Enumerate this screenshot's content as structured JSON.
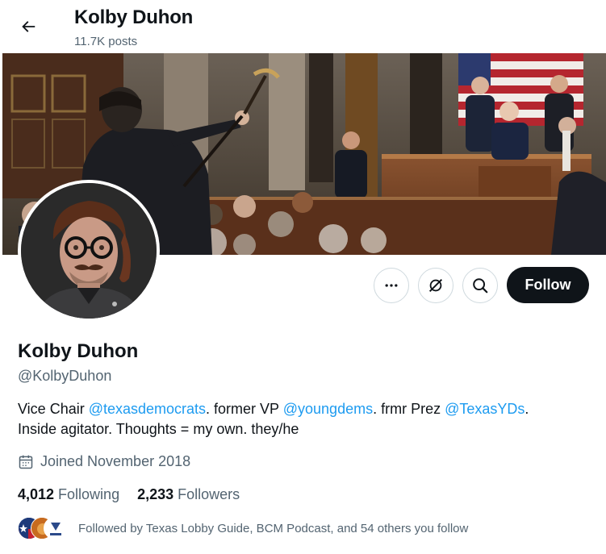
{
  "header": {
    "title": "Kolby Duhon",
    "posts_count": "11.7K posts",
    "back_icon": "arrow-left-icon"
  },
  "profile": {
    "name": "Kolby Duhon",
    "handle": "@KolbyDuhon",
    "bio": [
      {
        "text": "Vice Chair ",
        "type": "text"
      },
      {
        "text": "@texasdemocrats",
        "type": "mention"
      },
      {
        "text": ". former VP ",
        "type": "text"
      },
      {
        "text": "@youngdems",
        "type": "mention"
      },
      {
        "text": ". frmr Prez ",
        "type": "text"
      },
      {
        "text": "@TexasYDs",
        "type": "mention"
      },
      {
        "text": ".\nInside agitator. Thoughts = my own. they/he",
        "type": "text"
      }
    ],
    "joined": "Joined November 2018",
    "following_count": "4,012",
    "following_label": "Following",
    "followers_count": "2,233",
    "followers_label": "Followers",
    "followed_by": "Followed by Texas Lobby Guide, BCM Podcast, and 54 others you follow"
  },
  "actions": {
    "more_icon": "more-dots-icon",
    "grok_icon": "grok-icon",
    "search_icon": "search-icon",
    "follow_label": "Follow"
  },
  "colors": {
    "accent": "#1d9bf0",
    "text_primary": "#0f1419",
    "text_secondary": "#536471",
    "follow_bg": "#0f1419",
    "border": "#cfd9de"
  }
}
